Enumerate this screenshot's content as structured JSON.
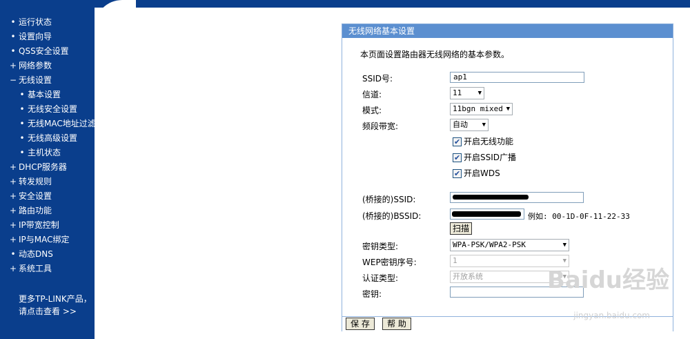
{
  "sidebar": {
    "items": [
      {
        "marker": "•",
        "label": "运行状态",
        "level": 0
      },
      {
        "marker": "•",
        "label": "设置向导",
        "level": 0
      },
      {
        "marker": "•",
        "label": "QSS安全设置",
        "level": 0
      },
      {
        "marker": "+",
        "label": "网络参数",
        "level": 0
      },
      {
        "marker": "−",
        "label": "无线设置",
        "level": 0
      },
      {
        "marker": "•",
        "label": "基本设置",
        "level": 1
      },
      {
        "marker": "•",
        "label": "无线安全设置",
        "level": 1
      },
      {
        "marker": "•",
        "label": "无线MAC地址过滤",
        "level": 1
      },
      {
        "marker": "•",
        "label": "无线高级设置",
        "level": 1
      },
      {
        "marker": "•",
        "label": "主机状态",
        "level": 1
      },
      {
        "marker": "+",
        "label": "DHCP服务器",
        "level": 0
      },
      {
        "marker": "+",
        "label": "转发规则",
        "level": 0
      },
      {
        "marker": "+",
        "label": "安全设置",
        "level": 0
      },
      {
        "marker": "+",
        "label": "路由功能",
        "level": 0
      },
      {
        "marker": "+",
        "label": "IP带宽控制",
        "level": 0
      },
      {
        "marker": "+",
        "label": "IP与MAC绑定",
        "level": 0
      },
      {
        "marker": "•",
        "label": "动态DNS",
        "level": 0
      },
      {
        "marker": "+",
        "label": "系统工具",
        "level": 0
      }
    ],
    "more_line1": "更多TP-LINK产品，",
    "more_line2": "请点击查看 >>"
  },
  "panel": {
    "title": "无线网络基本设置",
    "intro": "本页面设置路由器无线网络的基本参数。",
    "ssid_label": "SSID号:",
    "ssid_value": "ap1",
    "channel_label": "信道:",
    "channel_value": "11",
    "mode_label": "模式:",
    "mode_value": "11bgn mixed",
    "bandwidth_label": "频段带宽:",
    "bandwidth_value": "自动",
    "enable_wireless": "开启无线功能",
    "enable_ssid_broadcast": "开启SSID广播",
    "enable_wds": "开启WDS",
    "bridge_ssid_label": "(桥接的)SSID:",
    "bridge_bssid_label": "(桥接的)BSSID:",
    "bssid_example": "例如: 00-1D-0F-11-22-33",
    "scan_button": "扫描",
    "key_type_label": "密钥类型:",
    "key_type_value": "WPA-PSK/WPA2-PSK",
    "wep_index_label": "WEP密钥序号:",
    "wep_index_value": "1",
    "auth_type_label": "认证类型:",
    "auth_type_value": "开放系统",
    "key_label": "密钥:",
    "key_value": "",
    "save_button": "保 存",
    "help_button": "帮 助"
  },
  "watermark": {
    "logo_text": "Baidu经验",
    "url": "jingyan.baidu.com"
  },
  "colors": {
    "sidebar_bg": "#0a3e8c",
    "panel_title_bg": "#5b8fd0",
    "panel_border": "#8fb1dc"
  }
}
